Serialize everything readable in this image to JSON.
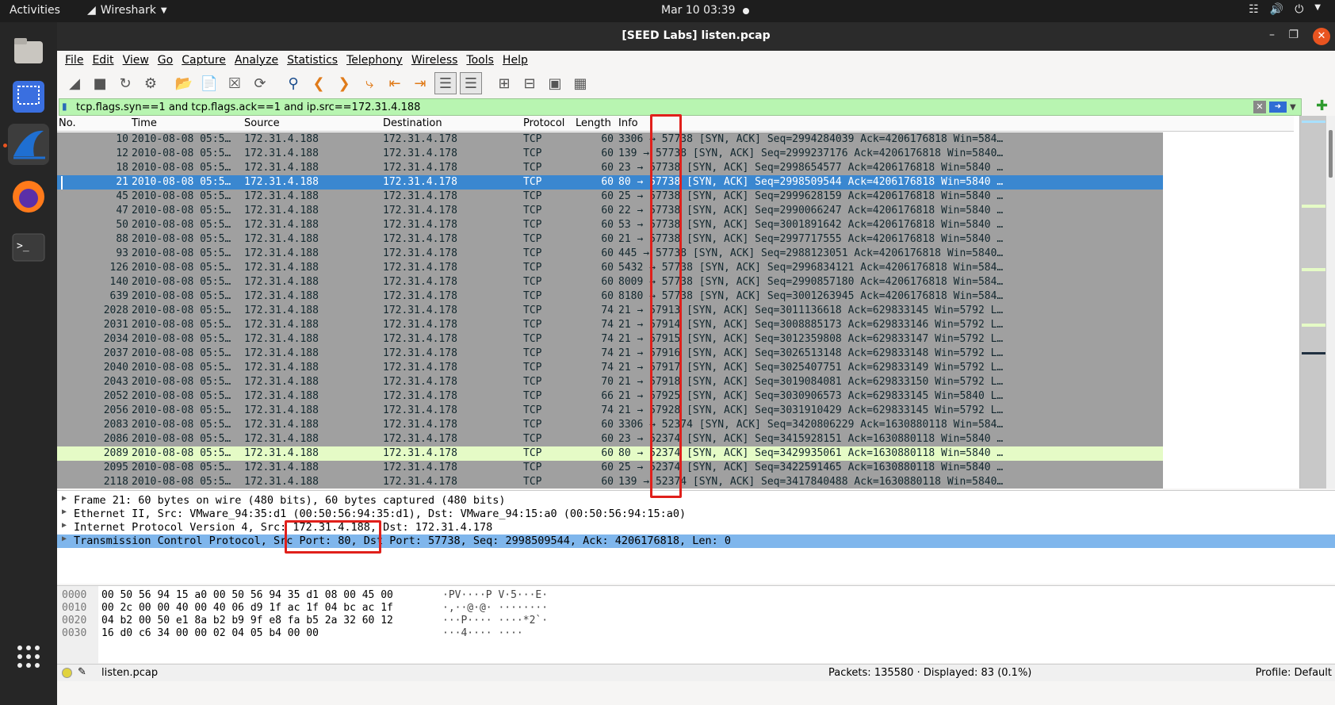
{
  "topbar": {
    "activities": "Activities",
    "app_name": "Wireshark",
    "clock": "Mar 10  03:39"
  },
  "window": {
    "title": "[SEED Labs] listen.pcap"
  },
  "menu": [
    "File",
    "Edit",
    "View",
    "Go",
    "Capture",
    "Analyze",
    "Statistics",
    "Telephony",
    "Wireless",
    "Tools",
    "Help"
  ],
  "filter": {
    "value": "tcp.flags.syn==1 and tcp.flags.ack==1 and ip.src==172.31.4.188",
    "bg_color": "#b8f5b1"
  },
  "packet_list": {
    "columns": [
      "No.",
      "Time",
      "Source",
      "Destination",
      "Protocol",
      "Length",
      "Info"
    ],
    "rows": [
      {
        "no": "10",
        "time": "2010-08-08 05:5…",
        "src": "172.31.4.188",
        "dst": "172.31.4.178",
        "proto": "TCP",
        "len": "60",
        "info": "3306 → 57738 [SYN, ACK] Seq=2994284039 Ack=4206176818 Win=584…"
      },
      {
        "no": "12",
        "time": "2010-08-08 05:5…",
        "src": "172.31.4.188",
        "dst": "172.31.4.178",
        "proto": "TCP",
        "len": "60",
        "info": "139 → 57738 [SYN, ACK] Seq=2999237176 Ack=4206176818 Win=5840…"
      },
      {
        "no": "18",
        "time": "2010-08-08 05:5…",
        "src": "172.31.4.188",
        "dst": "172.31.4.178",
        "proto": "TCP",
        "len": "60",
        "info": "23 → 57738 [SYN, ACK] Seq=2998654577 Ack=4206176818 Win=5840 …"
      },
      {
        "no": "21",
        "time": "2010-08-08 05:5…",
        "src": "172.31.4.188",
        "dst": "172.31.4.178",
        "proto": "TCP",
        "len": "60",
        "info": "80 → 57738 [SYN, ACK] Seq=2998509544 Ack=4206176818 Win=5840 …",
        "state": "selected"
      },
      {
        "no": "45",
        "time": "2010-08-08 05:5…",
        "src": "172.31.4.188",
        "dst": "172.31.4.178",
        "proto": "TCP",
        "len": "60",
        "info": "25 → 57738 [SYN, ACK] Seq=2999628159 Ack=4206176818 Win=5840 …"
      },
      {
        "no": "47",
        "time": "2010-08-08 05:5…",
        "src": "172.31.4.188",
        "dst": "172.31.4.178",
        "proto": "TCP",
        "len": "60",
        "info": "22 → 57738 [SYN, ACK] Seq=2990066247 Ack=4206176818 Win=5840 …"
      },
      {
        "no": "50",
        "time": "2010-08-08 05:5…",
        "src": "172.31.4.188",
        "dst": "172.31.4.178",
        "proto": "TCP",
        "len": "60",
        "info": "53 → 57738 [SYN, ACK] Seq=3001891642 Ack=4206176818 Win=5840 …"
      },
      {
        "no": "88",
        "time": "2010-08-08 05:5…",
        "src": "172.31.4.188",
        "dst": "172.31.4.178",
        "proto": "TCP",
        "len": "60",
        "info": "21 → 57738 [SYN, ACK] Seq=2997717555 Ack=4206176818 Win=5840 …"
      },
      {
        "no": "93",
        "time": "2010-08-08 05:5…",
        "src": "172.31.4.188",
        "dst": "172.31.4.178",
        "proto": "TCP",
        "len": "60",
        "info": "445 → 57738 [SYN, ACK] Seq=2988123051 Ack=4206176818 Win=5840…"
      },
      {
        "no": "126",
        "time": "2010-08-08 05:5…",
        "src": "172.31.4.188",
        "dst": "172.31.4.178",
        "proto": "TCP",
        "len": "60",
        "info": "5432 → 57738 [SYN, ACK] Seq=2996834121 Ack=4206176818 Win=584…"
      },
      {
        "no": "140",
        "time": "2010-08-08 05:5…",
        "src": "172.31.4.188",
        "dst": "172.31.4.178",
        "proto": "TCP",
        "len": "60",
        "info": "8009 → 57738 [SYN, ACK] Seq=2990857180 Ack=4206176818 Win=584…"
      },
      {
        "no": "639",
        "time": "2010-08-08 05:5…",
        "src": "172.31.4.188",
        "dst": "172.31.4.178",
        "proto": "TCP",
        "len": "60",
        "info": "8180 → 57738 [SYN, ACK] Seq=3001263945 Ack=4206176818 Win=584…"
      },
      {
        "no": "2028",
        "time": "2010-08-08 05:5…",
        "src": "172.31.4.188",
        "dst": "172.31.4.178",
        "proto": "TCP",
        "len": "74",
        "info": "21 → 57913 [SYN, ACK] Seq=3011136618 Ack=629833145 Win=5792 L…"
      },
      {
        "no": "2031",
        "time": "2010-08-08 05:5…",
        "src": "172.31.4.188",
        "dst": "172.31.4.178",
        "proto": "TCP",
        "len": "74",
        "info": "21 → 57914 [SYN, ACK] Seq=3008885173 Ack=629833146 Win=5792 L…"
      },
      {
        "no": "2034",
        "time": "2010-08-08 05:5…",
        "src": "172.31.4.188",
        "dst": "172.31.4.178",
        "proto": "TCP",
        "len": "74",
        "info": "21 → 57915 [SYN, ACK] Seq=3012359808 Ack=629833147 Win=5792 L…"
      },
      {
        "no": "2037",
        "time": "2010-08-08 05:5…",
        "src": "172.31.4.188",
        "dst": "172.31.4.178",
        "proto": "TCP",
        "len": "74",
        "info": "21 → 57916 [SYN, ACK] Seq=3026513148 Ack=629833148 Win=5792 L…"
      },
      {
        "no": "2040",
        "time": "2010-08-08 05:5…",
        "src": "172.31.4.188",
        "dst": "172.31.4.178",
        "proto": "TCP",
        "len": "74",
        "info": "21 → 57917 [SYN, ACK] Seq=3025407751 Ack=629833149 Win=5792 L…"
      },
      {
        "no": "2043",
        "time": "2010-08-08 05:5…",
        "src": "172.31.4.188",
        "dst": "172.31.4.178",
        "proto": "TCP",
        "len": "70",
        "info": "21 → 57918 [SYN, ACK] Seq=3019084081 Ack=629833150 Win=5792 L…"
      },
      {
        "no": "2052",
        "time": "2010-08-08 05:5…",
        "src": "172.31.4.188",
        "dst": "172.31.4.178",
        "proto": "TCP",
        "len": "66",
        "info": "21 → 57925 [SYN, ACK] Seq=3030906573 Ack=629833145 Win=5840 L…"
      },
      {
        "no": "2056",
        "time": "2010-08-08 05:5…",
        "src": "172.31.4.188",
        "dst": "172.31.4.178",
        "proto": "TCP",
        "len": "74",
        "info": "21 → 57928 [SYN, ACK] Seq=3031910429 Ack=629833145 Win=5792 L…"
      },
      {
        "no": "2083",
        "time": "2010-08-08 05:5…",
        "src": "172.31.4.188",
        "dst": "172.31.4.178",
        "proto": "TCP",
        "len": "60",
        "info": "3306 → 52374 [SYN, ACK] Seq=3420806229 Ack=1630880118 Win=584…"
      },
      {
        "no": "2086",
        "time": "2010-08-08 05:5…",
        "src": "172.31.4.188",
        "dst": "172.31.4.178",
        "proto": "TCP",
        "len": "60",
        "info": "23 → 52374 [SYN, ACK] Seq=3415928151 Ack=1630880118 Win=5840 …"
      },
      {
        "no": "2089",
        "time": "2010-08-08 05:5…",
        "src": "172.31.4.188",
        "dst": "172.31.4.178",
        "proto": "TCP",
        "len": "60",
        "info": "80 → 52374 [SYN, ACK] Seq=3429935061 Ack=1630880118 Win=5840 …",
        "state": "highlight"
      },
      {
        "no": "2095",
        "time": "2010-08-08 05:5…",
        "src": "172.31.4.188",
        "dst": "172.31.4.178",
        "proto": "TCP",
        "len": "60",
        "info": "25 → 52374 [SYN, ACK] Seq=3422591465 Ack=1630880118 Win=5840 …"
      },
      {
        "no": "2118",
        "time": "2010-08-08 05:5…",
        "src": "172.31.4.188",
        "dst": "172.31.4.178",
        "proto": "TCP",
        "len": "60",
        "info": "139 → 52374 [SYN, ACK] Seq=3417840488 Ack=1630880118 Win=5840…"
      }
    ]
  },
  "details": [
    {
      "text": "Frame 21: 60 bytes on wire (480 bits), 60 bytes captured (480 bits)",
      "selected": false
    },
    {
      "text": "Ethernet II, Src: VMware_94:35:d1 (00:50:56:94:35:d1), Dst: VMware_94:15:a0 (00:50:56:94:15:a0)",
      "selected": false
    },
    {
      "text": "Internet Protocol Version 4, Src: 172.31.4.188, Dst: 172.31.4.178",
      "selected": false
    },
    {
      "text": "Transmission Control Protocol, Src Port: 80, Dst Port: 57738, Seq: 2998509544, Ack: 4206176818, Len: 0",
      "selected": true
    }
  ],
  "bytes": [
    {
      "off": "0000",
      "hex": "00 50 56 94 15 a0 00 50  56 94 35 d1 08 00 45 00",
      "ascii": "·PV····P V·5···E·"
    },
    {
      "off": "0010",
      "hex": "00 2c 00 00 40 00 40 06  d9 1f ac 1f 04 bc ac 1f",
      "ascii": "·,··@·@· ········"
    },
    {
      "off": "0020",
      "hex": "04 b2 00 50 e1 8a b2 b9  9f e8 fa b5 2a 32 60 12",
      "ascii": "···P···· ····*2`·"
    },
    {
      "off": "0030",
      "hex": "16 d0 c6 34 00 00 02 04  05 b4 00 00",
      "ascii": "···4···· ····"
    }
  ],
  "status": {
    "file": "listen.pcap",
    "packets": "Packets: 135580 · Displayed: 83 (0.1%)",
    "profile": "Profile: Default"
  },
  "colors": {
    "selected_row": "#3a87d0",
    "row_bg": "#a0a0a0",
    "highlight_row": "#e5fbc6",
    "annotation": "#e0201b"
  }
}
